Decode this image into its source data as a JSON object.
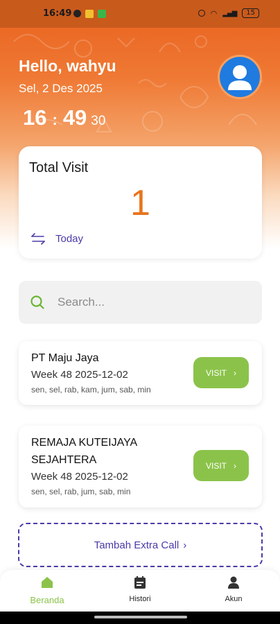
{
  "status_bar": {
    "time": "16:49",
    "battery": "15"
  },
  "header": {
    "greeting": "Hello, wahyu",
    "date": "Sel, 2 Des 2025",
    "clock_hour": "16",
    "clock_minute": "49",
    "clock_second": "30",
    "clock_separator": ":"
  },
  "visit_summary": {
    "title": "Total Visit",
    "count": "1",
    "period": "Today"
  },
  "search": {
    "placeholder": "Search...",
    "value": ""
  },
  "visits": [
    {
      "name": "PT Maju Jaya",
      "name_line2": "",
      "week": "Week 48 2025-12-02",
      "days": "sen, sel, rab, kam, jum, sab, min",
      "button": "VISIT"
    },
    {
      "name": "REMAJA KUTEIJAYA",
      "name_line2": "SEJAHTERA",
      "week": "Week 48 2025-12-02",
      "days": "sen, sel, rab, jum, sab, min",
      "button": "VISIT"
    }
  ],
  "extra_call": {
    "label": "Tambah Extra Call"
  },
  "bottom_nav": {
    "items": [
      {
        "label": "Beranda",
        "icon": "home-icon",
        "active": true
      },
      {
        "label": "Histori",
        "icon": "history-icon",
        "active": false
      },
      {
        "label": "Akun",
        "icon": "account-icon",
        "active": false
      }
    ]
  },
  "colors": {
    "brand_orange": "#e8601c",
    "count_orange": "#e8741c",
    "accent_green": "#8bc34a",
    "accent_purple": "#4a3aa8",
    "avatar_blue": "#1f7be0"
  }
}
